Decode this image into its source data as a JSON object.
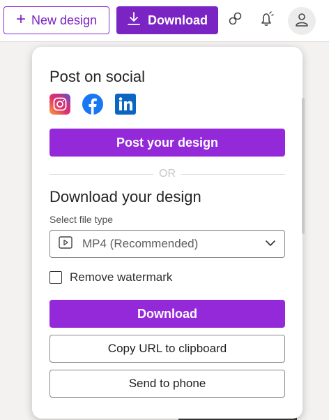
{
  "header": {
    "new_design_label": "New design",
    "download_label": "Download",
    "icons": [
      "plus-icon",
      "download-icon",
      "share-icon",
      "notifications-icon",
      "account-icon"
    ]
  },
  "panel": {
    "post_title": "Post on social",
    "socials": [
      "instagram",
      "facebook",
      "linkedin"
    ],
    "post_button": "Post your design",
    "or_text": "OR",
    "download_title": "Download your design",
    "file_type_label": "Select file type",
    "file_type_value": "MP4 (Recommended)",
    "remove_watermark_label": "Remove watermark",
    "remove_watermark_checked": false,
    "download_button": "Download",
    "copy_url_button": "Copy URL to clipboard",
    "send_phone_button": "Send to phone"
  },
  "colors": {
    "accent": "#9329d9",
    "accent_dark": "#7b24c4"
  }
}
